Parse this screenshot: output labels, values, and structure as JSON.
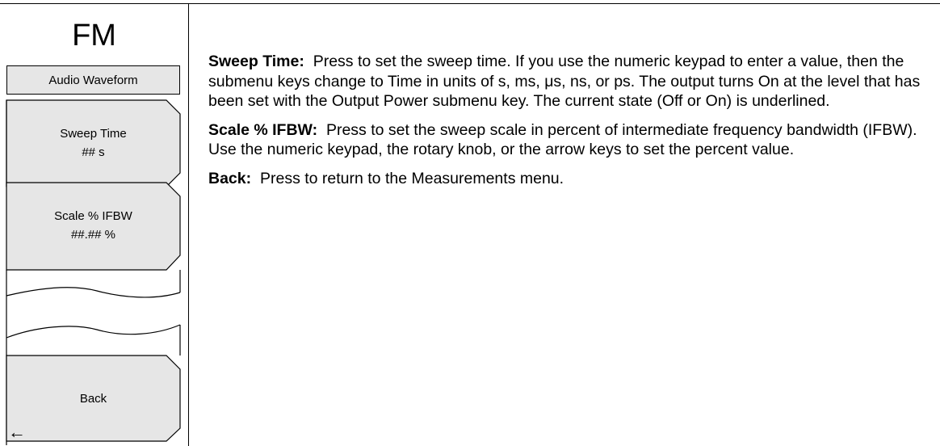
{
  "menu": {
    "title": "FM",
    "header": "Audio Waveform",
    "keys": [
      {
        "label": "Sweep Time",
        "value": "## s"
      },
      {
        "label": "Scale % IFBW",
        "value": "##.## %"
      },
      {
        "label": "Back",
        "arrow": "←"
      }
    ]
  },
  "descriptions": [
    {
      "term": "Sweep Time:",
      "text": "Press to set the sweep time. If you use the numeric keypad to enter a value, then the submenu keys change to Time in units of s, ms, μs, ns, or ps. The output turns On at the level that has been set with the Output Power submenu key. The current state (Off or On) is underlined."
    },
    {
      "term": "Scale % IFBW:",
      "text": "Press to set the sweep scale in percent of intermediate frequency bandwidth (IFBW). Use the numeric keypad, the rotary knob, or the arrow keys to set the percent value."
    },
    {
      "term": "Back:",
      "text": "Press to return to the Measurements menu."
    }
  ],
  "colors": {
    "key_fill": "#e6e6e6",
    "line": "#000000"
  }
}
